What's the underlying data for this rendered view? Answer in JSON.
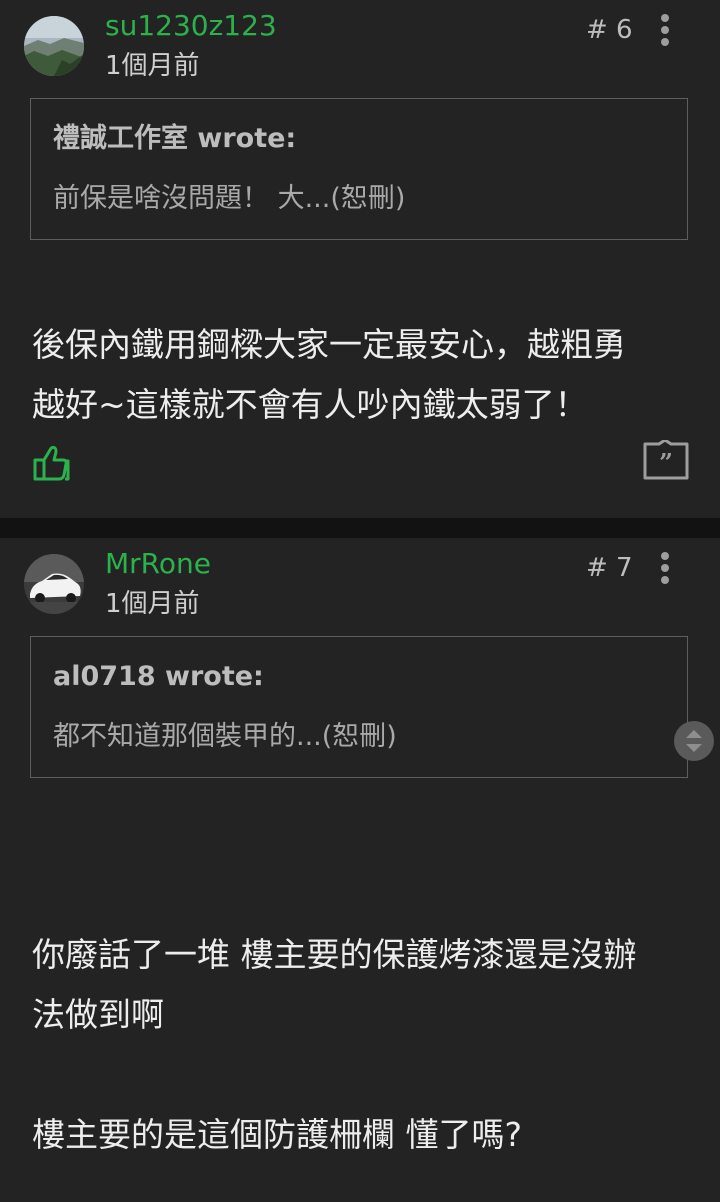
{
  "posts": [
    {
      "username": "su1230z123",
      "time": "1個月前",
      "floor": "# 6",
      "quote_author": "禮誠工作室 wrote:",
      "quote_text": "前保是啥沒問題！ 大...(恕刪)",
      "content": "後保內鐵用鋼樑大家一定最安心，越粗勇\n越好~這樣就不會有人吵內鐵太弱了！"
    },
    {
      "username": "MrRone",
      "time": "1個月前",
      "floor": "# 7",
      "quote_author": "al0718 wrote:",
      "quote_text": "都不知道那個裝甲的...(恕刪)",
      "content": "你廢話了一堆 樓主要的保護烤漆還是沒辦\n法做到啊\n\n樓主要的是這個防護柵欄 懂了嗎?"
    }
  ],
  "colors": {
    "background": "#232323",
    "separator": "#121212",
    "username": "#2bb24c",
    "like_icon": "#2bb24c",
    "text": "#ededed",
    "muted": "#a9a9a9",
    "quote_border": "#5e5e5e"
  },
  "icons": {
    "more": "more-vertical-icon",
    "like": "thumbs-up-icon",
    "quote": "quote-bubble-icon",
    "scroll": "scroll-handle-icon"
  }
}
